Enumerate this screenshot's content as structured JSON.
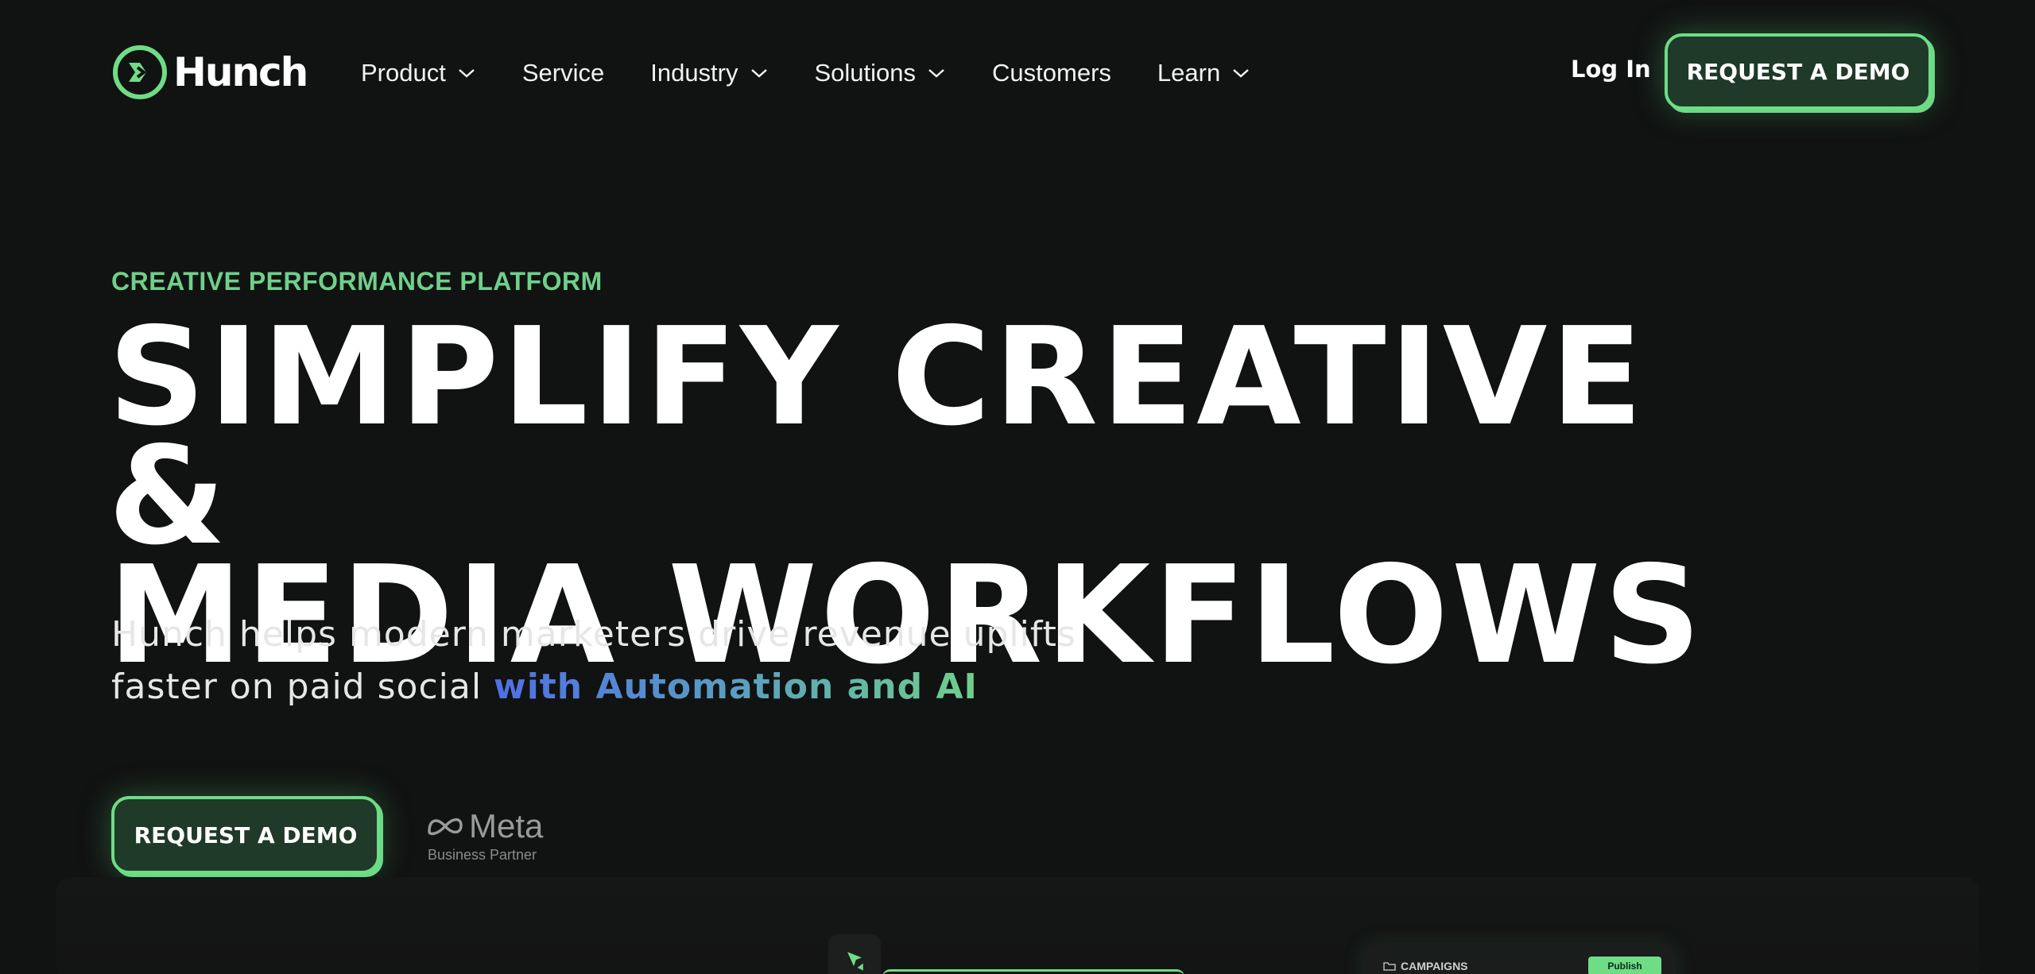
{
  "brand": {
    "name": "Hunch",
    "accent": "#6fdc86"
  },
  "nav": {
    "items": [
      {
        "label": "Product",
        "has_dropdown": true
      },
      {
        "label": "Service",
        "has_dropdown": false
      },
      {
        "label": "Industry",
        "has_dropdown": true
      },
      {
        "label": "Solutions",
        "has_dropdown": true
      },
      {
        "label": "Customers",
        "has_dropdown": false
      },
      {
        "label": "Learn",
        "has_dropdown": true
      }
    ],
    "login_label": "Log In",
    "cta_label": "REQUEST A DEMO"
  },
  "hero": {
    "eyebrow": "CREATIVE PERFORMANCE PLATFORM",
    "headline_line1": "SIMPLIFY CREATIVE &",
    "headline_line2": "MEDIA WORKFLOWS",
    "sub_line1": "Hunch helps modern marketers drive revenue uplifts",
    "sub_line2_plain": "faster on paid social ",
    "sub_line2_highlight": "with Automation and AI",
    "cta_label": "REQUEST A DEMO",
    "partner": {
      "name": "Meta",
      "caption": "Business Partner"
    }
  },
  "preview": {
    "campaigns_title": "CAMPAIGNS",
    "publish_label": "Publish"
  },
  "colors": {
    "background": "#111212",
    "eyebrow": "#6fd08a",
    "gradient_start": "#4f6fe6",
    "gradient_end": "#6fd08a",
    "button_fill": "#1f3a28"
  }
}
